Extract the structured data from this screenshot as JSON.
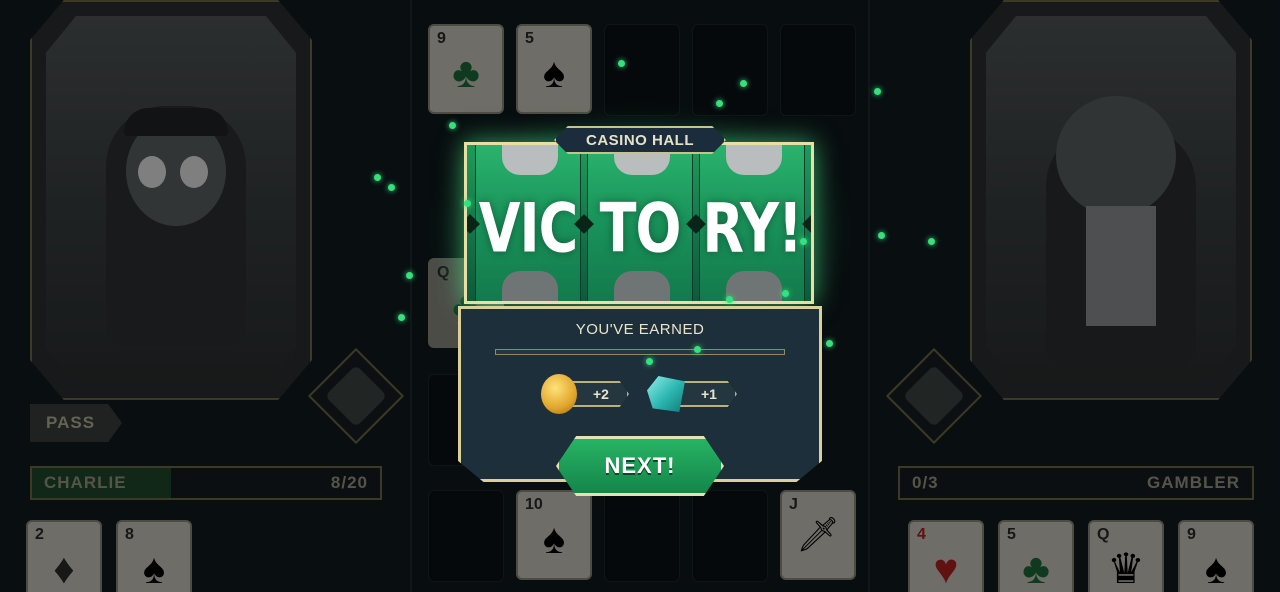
{
  "modal": {
    "location_label": "CASINO HALL",
    "victory_reels": [
      "VIC",
      "TO",
      "RY!"
    ],
    "earned_title": "YOU'VE EARNED",
    "rewards": [
      {
        "icon": "gold-coin-icon",
        "amount": "+2"
      },
      {
        "icon": "gem-icon",
        "amount": "+1"
      }
    ],
    "next_label": "NEXT!"
  },
  "player_left": {
    "name": "CHARLIE",
    "score": "8/20",
    "progress": 0.4,
    "pass_label": "PASS",
    "hand": [
      {
        "rank": "2",
        "suit": "♦",
        "color": "#2a2a2a"
      },
      {
        "rank": "8",
        "suit": "♠",
        "color": "#2a2a2a"
      }
    ]
  },
  "player_right": {
    "name": "GAMBLER",
    "score": "0/3",
    "hand": [
      {
        "rank": "4",
        "suit": "♥",
        "color": "#b02020"
      },
      {
        "rank": "5",
        "suit": "♣",
        "color": "#1d6b3a"
      },
      {
        "rank": "Q",
        "suit": "♛",
        "color": "#2a2a2a"
      },
      {
        "rank": "9",
        "suit": "♠",
        "color": "#2a2a2a"
      }
    ]
  },
  "board": {
    "top_cards": [
      {
        "rank": "9",
        "suit": "♣",
        "color": "#1d6b3a"
      },
      {
        "rank": "5",
        "suit": "♠",
        "color": "#2a2a2a"
      }
    ],
    "side_cards": [
      {
        "rank": "Q",
        "suit": "♣",
        "color": "#1d6b3a"
      }
    ],
    "bottom_cards": [
      {
        "rank": "10",
        "suit": "♠",
        "color": "#2a2a2a"
      },
      {
        "rank": "J",
        "suit": "♦",
        "color": "#2a2a2a"
      }
    ]
  },
  "colors": {
    "accent_green": "#1f9a5a",
    "gold_border": "#d9d197",
    "panel_bg": "#1d2f3b"
  }
}
